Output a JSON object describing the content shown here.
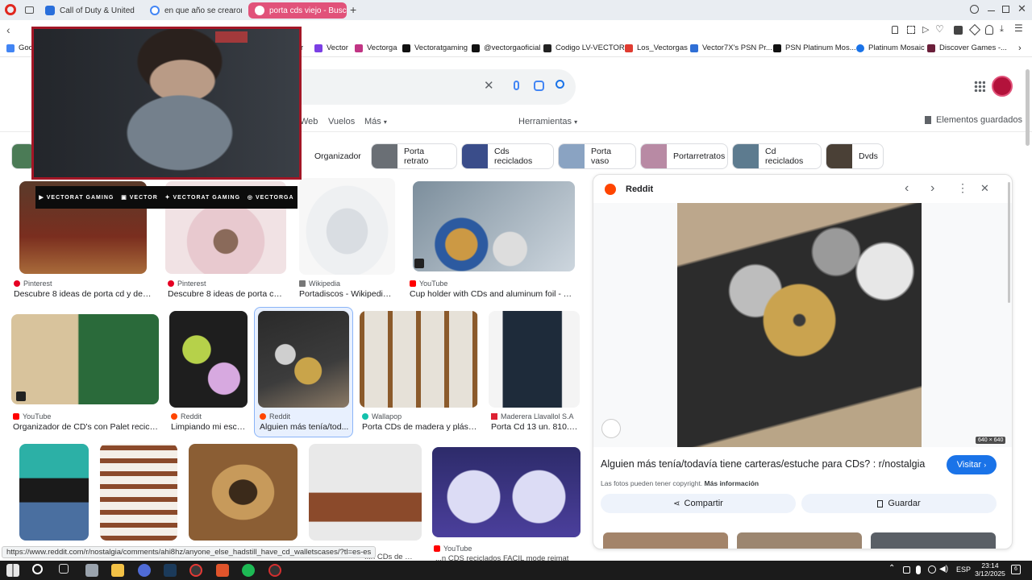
{
  "browser": {
    "tabs": [
      {
        "title": "Call of Duty & United Offe",
        "color": "#2a6fdb"
      },
      {
        "title": "en que año se crearon lo",
        "color": "#4285f4"
      },
      {
        "title": "porta cds viejo - Buscar",
        "color": "#ffffff"
      }
    ],
    "new_tab_label": "+"
  },
  "bookmarks": [
    {
      "label": "Goog",
      "color": "#4285f4"
    },
    {
      "label": "r",
      "color": "#ff4500"
    },
    {
      "label": "Vector",
      "color": "#7b3fe4"
    },
    {
      "label": "Vectorga",
      "color": "#c13584"
    },
    {
      "label": "Vectoratgaming",
      "color": "#111111"
    },
    {
      "label": "@vectorgaoficial",
      "color": "#111111"
    },
    {
      "label": "Codigo LV-VECTOR",
      "color": "#222222"
    },
    {
      "label": "Los_Vectorgas",
      "color": "#e03c31"
    },
    {
      "label": "Vector7X's PSN Pr...",
      "color": "#2f6fd6"
    },
    {
      "label": "PSN Platinum Mos...",
      "color": "#111111"
    },
    {
      "label": "Platinum Mosaic",
      "color": "#1a73e8"
    },
    {
      "label": "Discover Games -...",
      "color": "#6b1f3a"
    }
  ],
  "search": {
    "nav": [
      "Web",
      "Vuelos",
      "Más"
    ],
    "tools_label": "Herramientas",
    "saved_label": "Elementos guardados"
  },
  "chips": [
    {
      "label": "Organizador"
    },
    {
      "label": "Porta retrato"
    },
    {
      "label": "Cds reciclados"
    },
    {
      "label": "Porta vaso"
    },
    {
      "label": "Portarretratos"
    },
    {
      "label": "Cd reciclados"
    },
    {
      "label": "Dvds"
    }
  ],
  "results": [
    {
      "source": "Pinterest",
      "title": "Descubre 8 ideas de porta cd y decor...",
      "src_color": "#e60023"
    },
    {
      "source": "Pinterest",
      "title": "Descubre 8 ideas de porta cd y...",
      "src_color": "#e60023"
    },
    {
      "source": "Wikipedia",
      "title": "Portadiscos - Wikipedia, l...",
      "src_color": "#777777"
    },
    {
      "source": "YouTube",
      "title": "Cup holder with CDs and aluminum foil - YouT...",
      "src_color": "#ff0000"
    },
    {
      "source": "YouTube",
      "title": "Organizador de CD's con Palet recicla...",
      "src_color": "#ff0000"
    },
    {
      "source": "Reddit",
      "title": "Limpiando mi escri...",
      "src_color": "#ff4500"
    },
    {
      "source": "Reddit",
      "title": "Alguien más tenía/tod...",
      "src_color": "#ff4500"
    },
    {
      "source": "Wallapop",
      "title": "Porta CDs de madera y plástic...",
      "src_color": "#13c1ac"
    },
    {
      "source": "Maderera Llavallol S.A",
      "title": "Porta Cd 13 un. 810.6...",
      "src_color": "#d23"
    },
    {
      "source": "YouTube",
      "title": "",
      "src_color": "#ff0000"
    }
  ],
  "partial_row_texts": [
    "...n CDs de m...",
    "...n CDS reciclados FACIL mode reimat"
  ],
  "panel": {
    "source": "Reddit",
    "dimensions": "640 × 640",
    "title": "Alguien más tenía/todavía tiene carteras/estuche para CDs? : r/nostalgia",
    "visit_label": "Visitar",
    "copyright": "Las fotos pueden tener copyright.",
    "more_info": "Más información",
    "share_label": "Compartir",
    "save_label": "Guardar"
  },
  "webcam": {
    "social": [
      "VECTORAT GAMING",
      "VECTOR",
      "VECTORAT GAMING",
      "VECTORGA"
    ]
  },
  "status_url": "https://www.reddit.com/r/nostalgia/comments/ahi8hz/anyone_else_hadstill_have_cd_walletscases/?tl=es-es",
  "taskbar": {
    "language": "ESP",
    "time": "23:14",
    "date": "3/12/2025",
    "notifications": "6"
  },
  "colors": {
    "active_tab": "#e1527a",
    "visit_button": "#1a73e8",
    "webcam_border": "#a31626"
  }
}
